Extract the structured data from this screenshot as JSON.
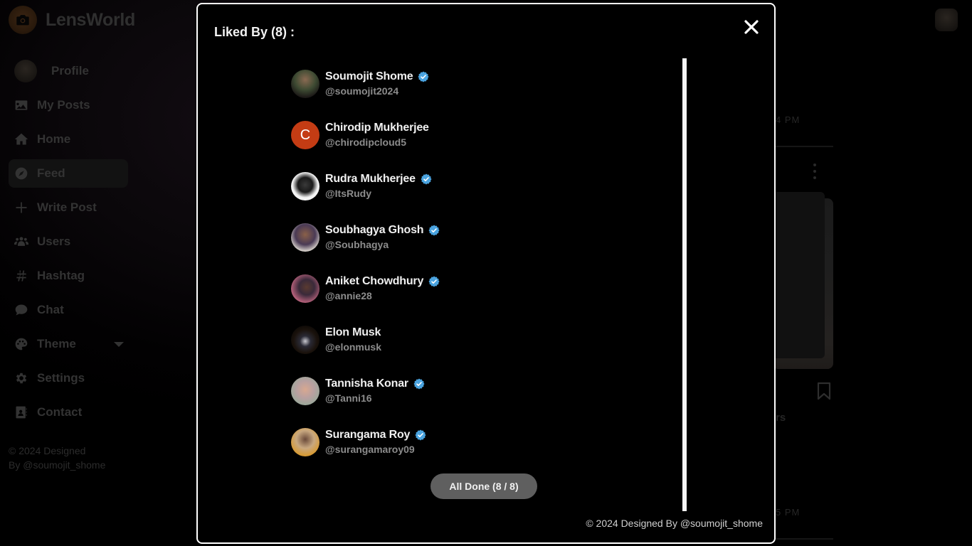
{
  "app": {
    "brand_name": "LensWorld",
    "brand_icon": "camera-icon"
  },
  "sidebar": {
    "items": [
      {
        "label": "Profile",
        "icon": "profile-avatar"
      },
      {
        "label": "My Posts",
        "icon": "image-icon"
      },
      {
        "label": "Home",
        "icon": "home-icon"
      },
      {
        "label": "Feed",
        "icon": "compass-icon",
        "active": true
      },
      {
        "label": "Write Post",
        "icon": "plus-icon"
      },
      {
        "label": "Users",
        "icon": "users-icon"
      },
      {
        "label": "Hashtag",
        "icon": "hashtag-icon"
      },
      {
        "label": "Chat",
        "icon": "chat-icon"
      },
      {
        "label": "Theme",
        "icon": "palette-icon",
        "has_dropdown": true
      },
      {
        "label": "Settings",
        "icon": "gear-icon"
      },
      {
        "label": "Contact",
        "icon": "contact-icon"
      }
    ],
    "footer_line1": "© 2024 Designed",
    "footer_line2": "By @soumojit_shome"
  },
  "feed_background": {
    "post1_time_fragment": "4 PM",
    "post2_caption_fragment": "rs",
    "post2_time_fragment": "5 PM"
  },
  "modal": {
    "title": "Liked By (8) :",
    "likers": [
      {
        "name": "Soumojit Shome",
        "handle": "@soumojit2024",
        "verified": true,
        "avatar": "photo"
      },
      {
        "name": "Chirodip Mukherjee",
        "handle": "@chirodipcloud5",
        "verified": false,
        "avatar": "letter",
        "letter": "C"
      },
      {
        "name": "Rudra Mukherjee",
        "handle": "@ItsRudy",
        "verified": true,
        "avatar": "photo"
      },
      {
        "name": "Soubhagya Ghosh",
        "handle": "@Soubhagya",
        "verified": true,
        "avatar": "photo"
      },
      {
        "name": "Aniket Chowdhury",
        "handle": "@annie28",
        "verified": true,
        "avatar": "photo"
      },
      {
        "name": "Elon Musk",
        "handle": "@elonmusk",
        "verified": false,
        "avatar": "photo"
      },
      {
        "name": "Tannisha Konar",
        "handle": "@Tanni16",
        "verified": true,
        "avatar": "photo"
      },
      {
        "name": "Surangama Roy",
        "handle": "@surangamaroy09",
        "verified": true,
        "avatar": "photo"
      }
    ],
    "all_done_label": "All Done (8 / 8)",
    "footer": "© 2024 Designed By @soumojit_shome"
  },
  "colors": {
    "verified_badge": "#4aa3df",
    "letter_avatar_bg": "#c43c14",
    "button_bg": "#5f5f5f"
  }
}
